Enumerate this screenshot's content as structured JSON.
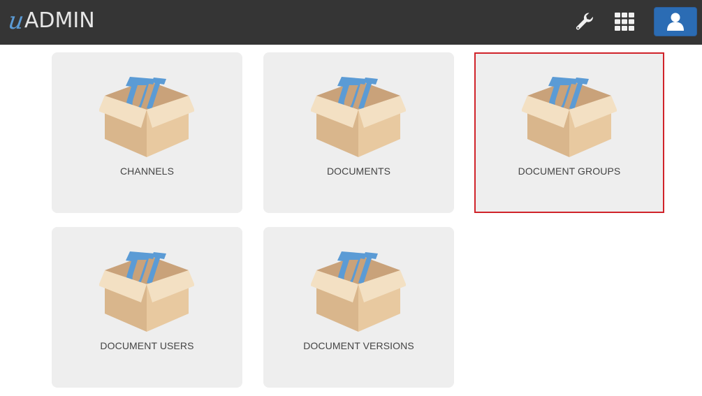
{
  "header": {
    "logo_letter": "u",
    "logo_text": "ADMIN",
    "icons": [
      "wrench-icon",
      "apps-grid-icon",
      "user-icon"
    ],
    "background": "#353535",
    "accent": "#2b6cb4"
  },
  "cards": [
    {
      "label": "CHANNELS",
      "selected": false
    },
    {
      "label": "DOCUMENTS",
      "selected": false
    },
    {
      "label": "DOCUMENT GROUPS",
      "selected": true
    },
    {
      "label": "DOCUMENT USERS",
      "selected": false
    },
    {
      "label": "DOCUMENT VERSIONS",
      "selected": false
    }
  ],
  "colors": {
    "card_background": "#eeeeee",
    "selection_outline": "#d0232a",
    "box_tan": "#e8c9a0",
    "box_letter": "#5b9bd5"
  }
}
